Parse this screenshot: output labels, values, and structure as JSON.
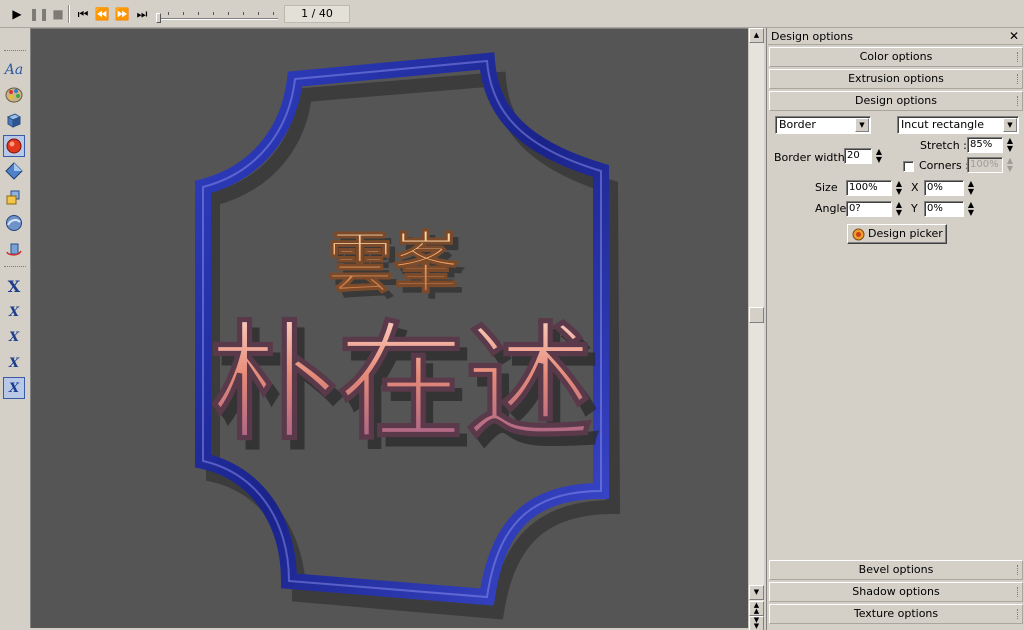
{
  "toolbar": {
    "frame_counter": "1 / 40",
    "buttons": [
      "play-icon",
      "pause-icon",
      "stop-icon",
      "first-frame-icon",
      "prev-frame-icon",
      "next-frame-icon",
      "last-frame-icon"
    ]
  },
  "palette": {
    "text_tool_label": "Aa",
    "x_tools": [
      "X",
      "X",
      "X",
      "X",
      "X"
    ]
  },
  "canvas": {
    "top_line_text": "雲峯",
    "bottom_line_text": "朴在述",
    "background_color": "#555555",
    "border_color": "#1c2a9c"
  },
  "panel": {
    "title": "Design options",
    "close_glyph": "✕",
    "sections_top": [
      "Color options",
      "Extrusion options",
      "Design options"
    ],
    "sections_bottom": [
      "Bevel options",
      "Shadow options",
      "Texture options"
    ],
    "design": {
      "type_select": "Border",
      "shape_select": "Incut rectangle",
      "stretch_label": "Stretch :",
      "stretch_value": "85%",
      "border_width_label": "Border width",
      "border_width_value": "20",
      "corners_label": "Corners :",
      "corners_value": "100%",
      "size_label": "Size",
      "size_value": "100%",
      "x_label": "X",
      "x_value": "0%",
      "angle_label": "Angle",
      "angle_value": "0?",
      "y_label": "Y",
      "y_value": "0%",
      "design_picker_label": "Design picker"
    }
  }
}
